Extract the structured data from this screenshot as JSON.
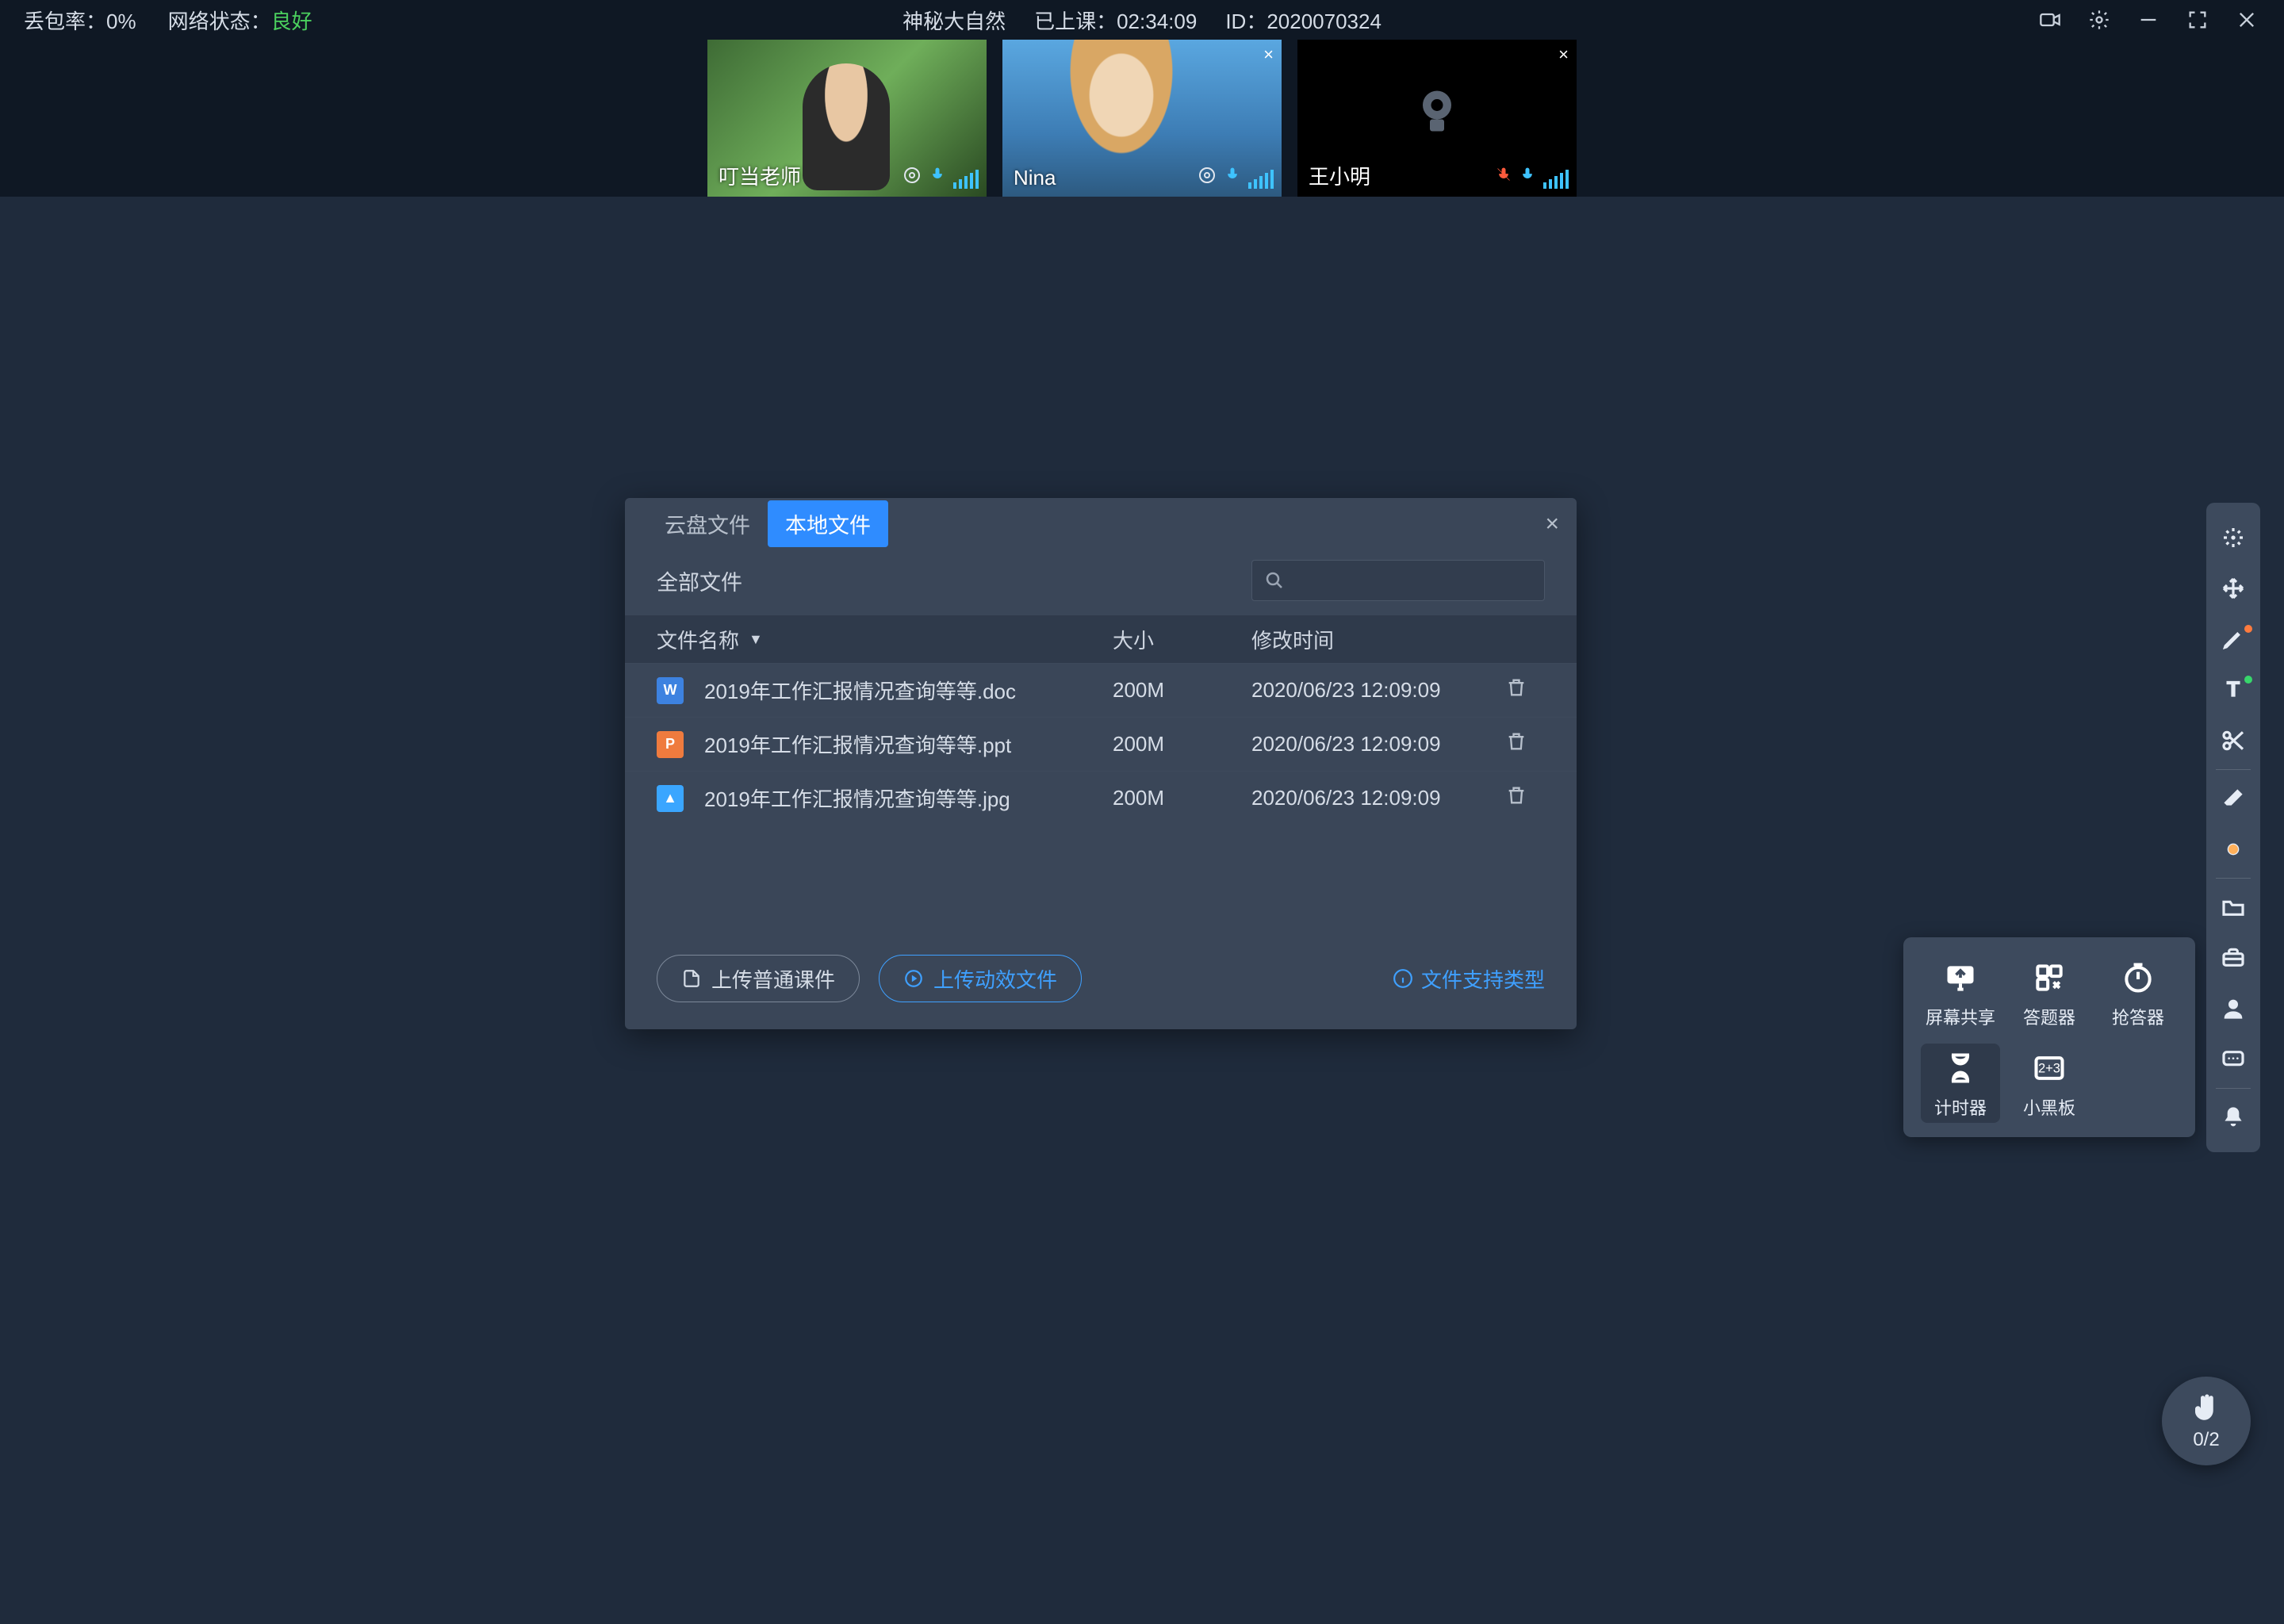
{
  "topbar": {
    "loss_label": "丢包率：",
    "loss_value": "0%",
    "net_label": "网络状态：",
    "net_value": "良好",
    "title": "神秘大自然",
    "elapsed_label": "已上课：",
    "elapsed_value": "02:34:09",
    "id_label": "ID：",
    "id_value": "2020070324"
  },
  "participants": [
    {
      "name": "叮当老师",
      "camera_off": false,
      "muted": false,
      "closable": false
    },
    {
      "name": "Nina",
      "camera_off": false,
      "muted": false,
      "closable": true
    },
    {
      "name": "王小明",
      "camera_off": true,
      "muted": true,
      "closable": true
    }
  ],
  "dialog": {
    "tabs": {
      "cloud": "云盘文件",
      "local": "本地文件",
      "active": "local"
    },
    "filter_label": "全部文件",
    "columns": {
      "name": "文件名称",
      "size": "大小",
      "time": "修改时间"
    },
    "rows": [
      {
        "icon": "w",
        "icon_letter": "W",
        "name": "2019年工作汇报情况查询等等.doc",
        "size": "200M",
        "time": "2020/06/23 12:09:09"
      },
      {
        "icon": "p",
        "icon_letter": "P",
        "name": "2019年工作汇报情况查询等等.ppt",
        "size": "200M",
        "time": "2020/06/23 12:09:09"
      },
      {
        "icon": "i",
        "icon_letter": "▲",
        "name": "2019年工作汇报情况查询等等.jpg",
        "size": "200M",
        "time": "2020/06/23 12:09:09"
      }
    ],
    "upload_normal": "上传普通课件",
    "upload_fx": "上传动效文件",
    "support": "文件支持类型"
  },
  "tool_pop": {
    "screen_share": "屏幕共享",
    "answer": "答题器",
    "buzzer": "抢答器",
    "timer": "计时器",
    "blackboard": "小黑板"
  },
  "rail_icons": [
    "laser-pointer-icon",
    "move-icon",
    "pen-icon",
    "text-icon",
    "scissors-icon",
    "eraser-icon",
    "dot-icon",
    "folder-icon",
    "toolbox-icon",
    "person-icon",
    "chat-icon",
    "bell-icon"
  ],
  "hand": {
    "count": "0/2"
  }
}
